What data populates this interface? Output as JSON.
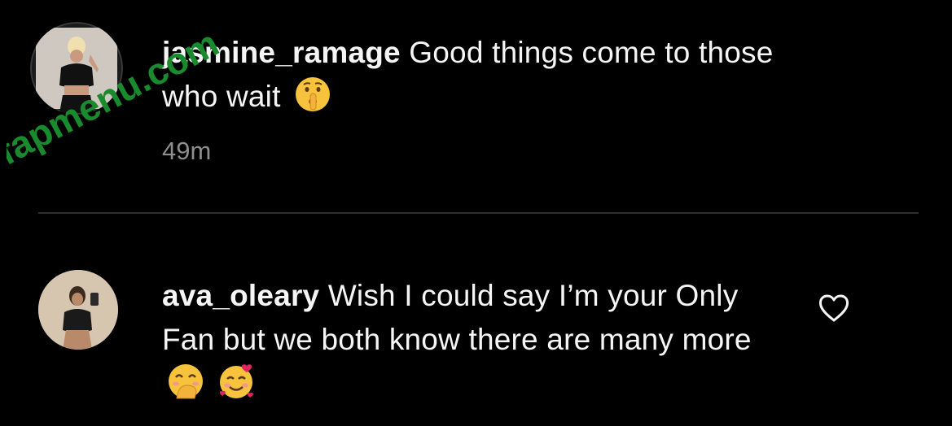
{
  "comments": [
    {
      "username": "jasmine_ramage",
      "text": "Good things come to those who wait",
      "emoji": "shushing-face",
      "timestamp": "49m"
    },
    {
      "username": "ava_oleary",
      "text": "Wish I could say I’m your Only Fan but we both know there are many more",
      "emojis": [
        "face-with-hand-over-mouth",
        "smiling-face-with-hearts"
      ]
    }
  ],
  "watermark": {
    "text": "fapmenu.com",
    "color": "#1a8a2e"
  },
  "colors": {
    "background": "#000000",
    "text": "#f5f5f5",
    "muted": "#8e8e8e",
    "divider": "#2e2e2e",
    "emoji_yellow": "#f7c23c",
    "heart_red": "#e0245e"
  },
  "icons": [
    "like-heart-outline-icon"
  ]
}
